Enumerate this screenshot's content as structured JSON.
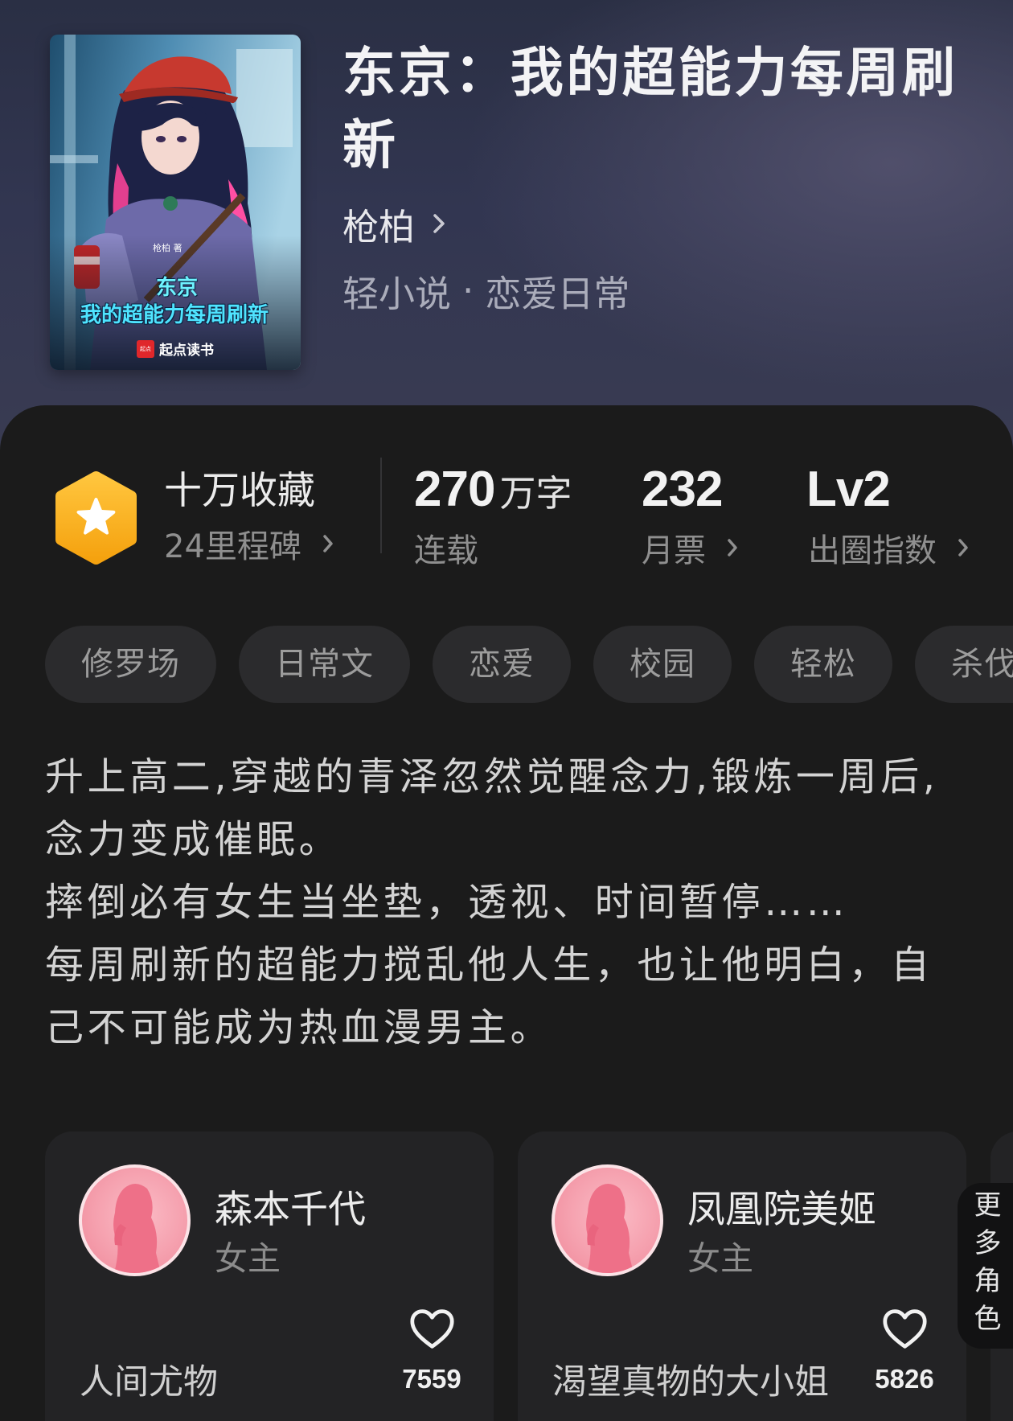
{
  "book": {
    "title": "东京：我的超能力每周刷新",
    "author": "枪柏",
    "category": "轻小说",
    "separator": "·",
    "subcategory": "恋爱日常",
    "cover": {
      "title_line1": "东京",
      "title_line2": "我的超能力每周刷新",
      "author_credit": "枪柏 著",
      "publisher_logo": "起点",
      "publisher": "起点读书"
    }
  },
  "stats": {
    "collection": {
      "label": "十万收藏",
      "milestone": "24里程碑",
      "icon": "star-hexagon-icon"
    },
    "word_count": {
      "value": "270",
      "unit": "万字",
      "status": "连载"
    },
    "monthly_ticket": {
      "value": "232",
      "label": "月票"
    },
    "influence": {
      "value": "Lv2",
      "label": "出圈指数"
    }
  },
  "tags": [
    "修罗场",
    "日常文",
    "恋爱",
    "校园",
    "轻松",
    "杀伐果"
  ],
  "synopsis": {
    "lines": [
      "升上高二,穿越的青泽忽然觉醒念力,锻炼一周后,",
      "念力变成催眠。",
      "摔倒必有女生当坐垫，透视、时间暂停……",
      "每周刷新的超能力搅乱他人生，也让他明白，自",
      "己不可能成为热血漫男主。"
    ]
  },
  "characters": [
    {
      "name": "森本千代",
      "role": "女主",
      "tagline": "人间尤物",
      "likes": "7559",
      "icon": "heart-icon"
    },
    {
      "name": "凤凰院美姬",
      "role": "女主",
      "tagline": "渴望真物的大小姐",
      "likes": "5826",
      "icon": "heart-icon"
    }
  ],
  "more_characters": "更多角色",
  "colors": {
    "panel_bg": "#1b1b1b",
    "card_bg": "#232325",
    "badge": "#f7b52f",
    "tag_bg": "#2b2b2d",
    "avatar_pink": "#f5a0ae"
  }
}
